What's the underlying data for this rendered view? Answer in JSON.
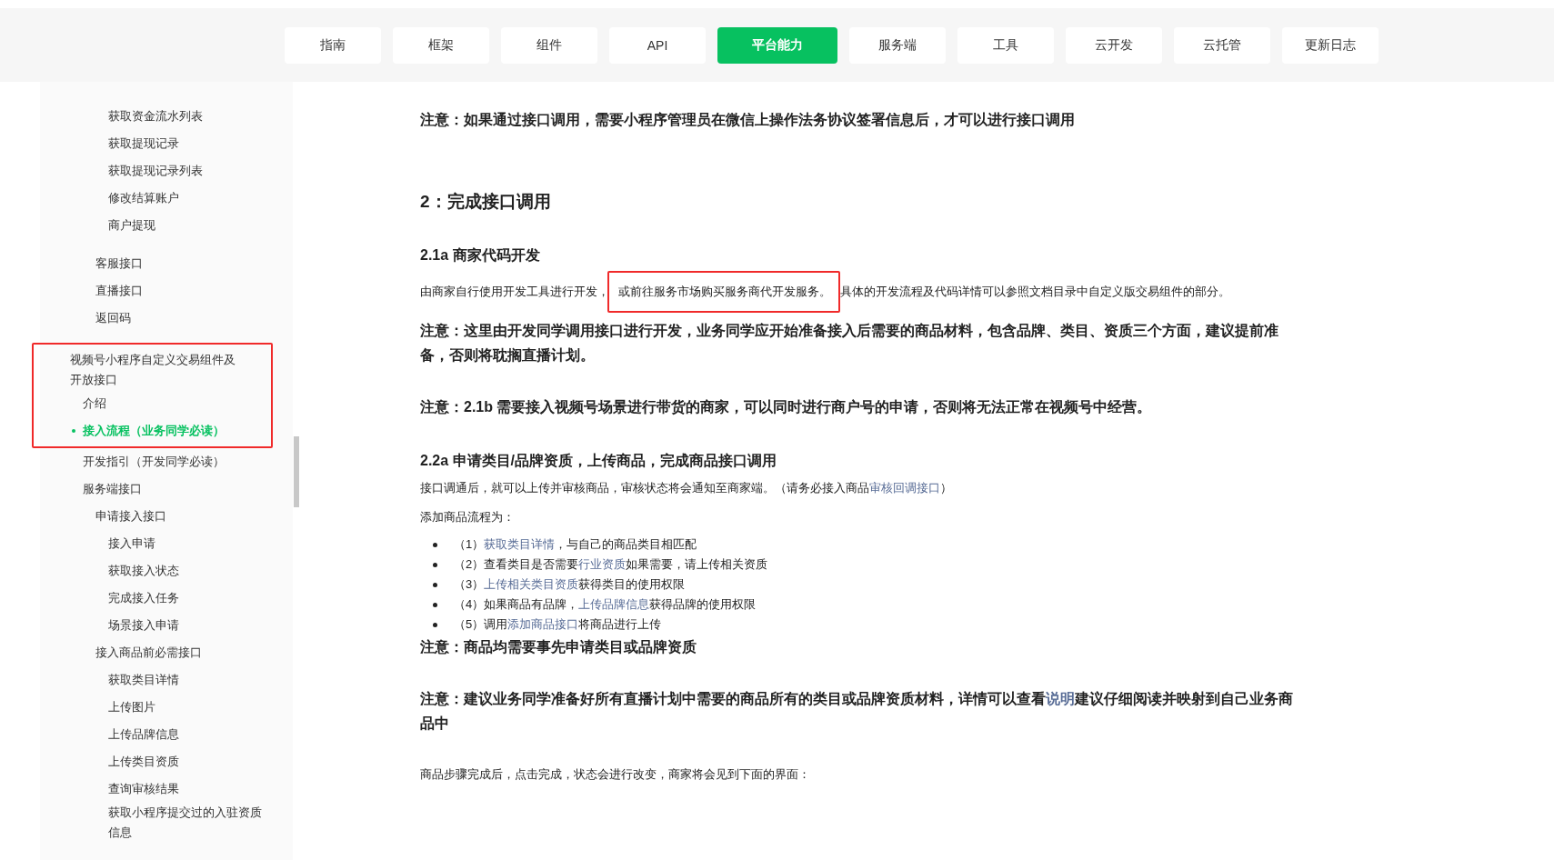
{
  "nav": {
    "tabs": [
      {
        "label": "指南",
        "selected": false
      },
      {
        "label": "框架",
        "selected": false
      },
      {
        "label": "组件",
        "selected": false
      },
      {
        "label": "API",
        "selected": false
      },
      {
        "label": "平台能力",
        "selected": true
      },
      {
        "label": "服务端",
        "selected": false
      },
      {
        "label": "工具",
        "selected": false
      },
      {
        "label": "云开发",
        "selected": false
      },
      {
        "label": "云托管",
        "selected": false
      },
      {
        "label": "更新日志",
        "selected": false
      }
    ]
  },
  "sidebar": {
    "groups": [
      {
        "items": [
          {
            "label": "获取资金流水列表",
            "selected": false,
            "framed": false
          },
          {
            "label": "获取提现记录",
            "selected": false,
            "framed": false
          },
          {
            "label": "获取提现记录列表",
            "selected": false,
            "framed": false
          },
          {
            "label": "修改结算账户",
            "selected": false,
            "framed": false
          },
          {
            "label": "商户提现",
            "selected": false,
            "framed": false
          }
        ]
      },
      {
        "items": [
          {
            "label": "客服接口",
            "selected": false,
            "framed": false
          },
          {
            "label": "直播接口",
            "selected": false,
            "framed": false
          },
          {
            "label": "返回码",
            "selected": false,
            "framed": false
          }
        ]
      },
      {
        "items": [
          {
            "label": "视频号小程序自定义交易组件及开放接口",
            "selected": false,
            "framed": true,
            "children": [
              {
                "label": "介绍",
                "selected": false,
                "framed": true
              },
              {
                "label": "接入流程（业务同学必读）",
                "selected": true,
                "framed": true
              },
              {
                "label": "开发指引（开发同学必读）",
                "selected": false,
                "framed": false
              },
              {
                "label": "服务端接口",
                "selected": false,
                "framed": false,
                "children": [
                  {
                    "label": "申请接入接口",
                    "selected": false,
                    "framed": false,
                    "children": [
                      {
                        "label": "接入申请",
                        "selected": false,
                        "framed": false
                      },
                      {
                        "label": "获取接入状态",
                        "selected": false,
                        "framed": false
                      },
                      {
                        "label": "完成接入任务",
                        "selected": false,
                        "framed": false
                      },
                      {
                        "label": "场景接入申请",
                        "selected": false,
                        "framed": false
                      }
                    ]
                  },
                  {
                    "label": "接入商品前必需接口",
                    "selected": false,
                    "framed": false,
                    "children": [
                      {
                        "label": "获取类目详情",
                        "selected": false,
                        "framed": false
                      },
                      {
                        "label": "上传图片",
                        "selected": false,
                        "framed": false
                      },
                      {
                        "label": "上传品牌信息",
                        "selected": false,
                        "framed": false
                      },
                      {
                        "label": "上传类目资质",
                        "selected": false,
                        "framed": false
                      },
                      {
                        "label": "查询审核结果",
                        "selected": false,
                        "framed": false
                      },
                      {
                        "label": "获取小程序提交过的入驻资质信息",
                        "selected": false,
                        "framed": false
                      }
                    ]
                  }
                ]
              }
            ]
          }
        ]
      }
    ]
  },
  "content": {
    "blocks": [
      {
        "kind": "note",
        "parts": [
          {
            "kind": "text",
            "text": "注意：如果通过接口调用，需要小程序管理员在微信上操作法务协议签署信息后，才可以进行接口调用"
          }
        ]
      },
      {
        "kind": "h2",
        "parts": [
          {
            "kind": "text",
            "text": "2：完成接口调用"
          }
        ]
      },
      {
        "kind": "h3",
        "parts": [
          {
            "kind": "text",
            "text": "2.1a 商家代码开发"
          }
        ]
      },
      {
        "kind": "para",
        "parts": [
          {
            "kind": "text",
            "text": "由商家自行使用开发工具进行开发，"
          },
          {
            "kind": "highlight",
            "text": "或前往服务市场购买服务商代开发服务。"
          },
          {
            "kind": "text",
            "text": "具体的开发流程及代码详情可以参照文档目录中自定义版交易组件的部分。"
          }
        ]
      },
      {
        "kind": "note",
        "parts": [
          {
            "kind": "text",
            "text": "注意：这里由开发同学调用接口进行开发，业务同学应开始准备接入后需要的商品材料，包含品牌、类目、资质三个方面，建议提前准备，否则将耽搁直播计划。"
          }
        ]
      },
      {
        "kind": "note",
        "parts": [
          {
            "kind": "text",
            "text": "注意：2.1b 需要接入视频号场景进行带货的商家，可以同时进行商户号的申请，否则将无法正常在视频号中经营。"
          }
        ]
      },
      {
        "kind": "h3",
        "parts": [
          {
            "kind": "text",
            "text": "2.2a 申请类目/品牌资质，上传商品，完成商品接口调用"
          }
        ]
      },
      {
        "kind": "para",
        "parts": [
          {
            "kind": "text",
            "text": "接口调通后，就可以上传并审核商品，审核状态将会通知至商家端。（请务必接入商品"
          },
          {
            "kind": "link",
            "text": "审核回调接口"
          },
          {
            "kind": "text",
            "text": "）"
          }
        ]
      },
      {
        "kind": "para",
        "parts": [
          {
            "kind": "text",
            "text": "添加商品流程为："
          }
        ]
      },
      {
        "kind": "item",
        "parts": [
          {
            "kind": "text",
            "text": "（1）"
          },
          {
            "kind": "link",
            "text": "获取类目详情"
          },
          {
            "kind": "text",
            "text": "，与自己的商品类目相匹配"
          }
        ]
      },
      {
        "kind": "item",
        "parts": [
          {
            "kind": "text",
            "text": "（2）查看类目是否需要"
          },
          {
            "kind": "link",
            "text": "行业资质"
          },
          {
            "kind": "text",
            "text": "如果需要，请上传相关资质"
          }
        ]
      },
      {
        "kind": "item",
        "parts": [
          {
            "kind": "text",
            "text": "（3）"
          },
          {
            "kind": "link",
            "text": "上传相关类目资质"
          },
          {
            "kind": "text",
            "text": "获得类目的使用权限"
          }
        ]
      },
      {
        "kind": "item",
        "parts": [
          {
            "kind": "text",
            "text": "（4）如果商品有品牌，"
          },
          {
            "kind": "link",
            "text": "上传品牌信息"
          },
          {
            "kind": "text",
            "text": "获得品牌的使用权限"
          }
        ]
      },
      {
        "kind": "item",
        "parts": [
          {
            "kind": "text",
            "text": "（5）调用"
          },
          {
            "kind": "link",
            "text": "添加商品接口"
          },
          {
            "kind": "text",
            "text": "将商品进行上传"
          }
        ]
      },
      {
        "kind": "note",
        "parts": [
          {
            "kind": "text",
            "text": "注意：商品均需要事先申请类目或品牌资质"
          }
        ]
      },
      {
        "kind": "note",
        "parts": [
          {
            "kind": "text",
            "text": "注意：建议业务同学准备好所有直播计划中需要的商品所有的类目或品牌资质材料，详情可以查看"
          },
          {
            "kind": "link",
            "text": "说明"
          },
          {
            "kind": "text",
            "text": "建议仔细阅读并映射到自己业务商品中"
          }
        ]
      },
      {
        "kind": "para",
        "parts": [
          {
            "kind": "text",
            "text": "商品步骤完成后，点击完成，状态会进行改变，商家将会见到下面的界面："
          }
        ]
      }
    ]
  }
}
